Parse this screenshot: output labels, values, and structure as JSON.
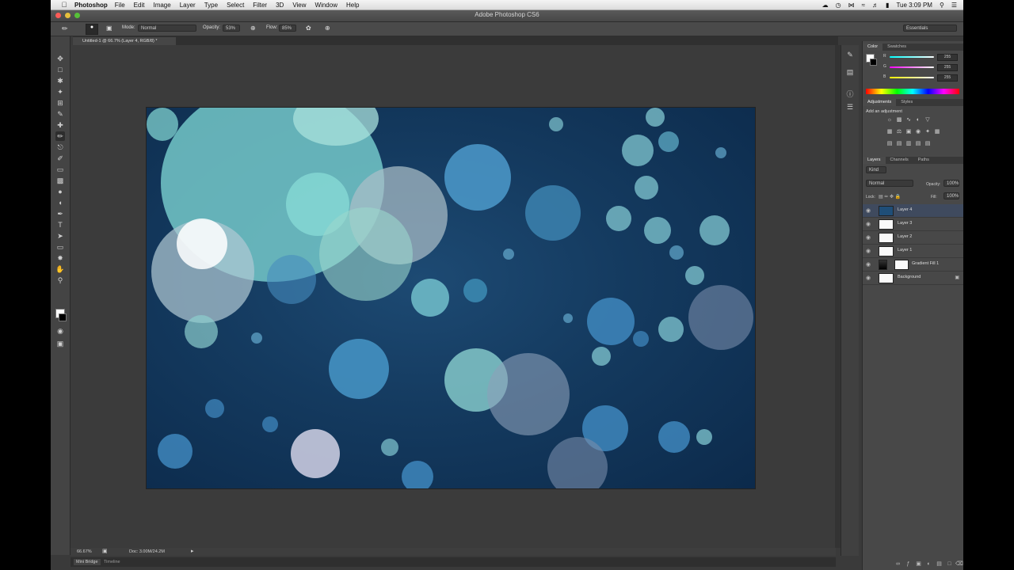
{
  "menubar": {
    "app_name": "Photoshop",
    "items": [
      "File",
      "Edit",
      "Image",
      "Layer",
      "Type",
      "Select",
      "Filter",
      "3D",
      "View",
      "Window",
      "Help"
    ],
    "clock": "Tue 3:09 PM"
  },
  "window": {
    "title": "Adobe Photoshop CS6"
  },
  "options": {
    "mode_label": "Mode:",
    "mode_value": "Normal",
    "opacity_label": "Opacity:",
    "opacity_value": "53%",
    "flow_label": "Flow:",
    "flow_value": "85%",
    "workspace": "Essentials"
  },
  "document_tab": "Untitled-1 @ 66.7% (Layer 4, RGB/8) *",
  "status": {
    "zoom": "66.67%",
    "doc_size": "Doc: 3.00M/24.2M"
  },
  "bottom_tabs": [
    "Mini Bridge",
    "Timeline"
  ],
  "color_panel": {
    "tabs": [
      "Color",
      "Swatches"
    ],
    "channels": [
      {
        "label": "R",
        "value": "255"
      },
      {
        "label": "G",
        "value": "255"
      },
      {
        "label": "B",
        "value": "255"
      }
    ]
  },
  "adjustments_panel": {
    "tabs": [
      "Adjustments",
      "Styles"
    ],
    "heading": "Add an adjustment"
  },
  "layers_panel": {
    "tabs": [
      "Layers",
      "Channels",
      "Paths"
    ],
    "filter_kind": "Kind",
    "blend_mode": "Normal",
    "opacity_label": "Opacity:",
    "opacity_value": "100%",
    "lock_label": "Lock:",
    "fill_label": "Fill:",
    "fill_value": "100%",
    "layers": [
      "Layer 4",
      "Layer 3",
      "Layer 2",
      "Layer 1",
      "Gradient Fill 1",
      "Background"
    ]
  },
  "colors": {
    "canvas_dark": "#0c2a4b",
    "canvas_mid": "#1d4a73",
    "selected_layer": "#3f4a5e"
  }
}
